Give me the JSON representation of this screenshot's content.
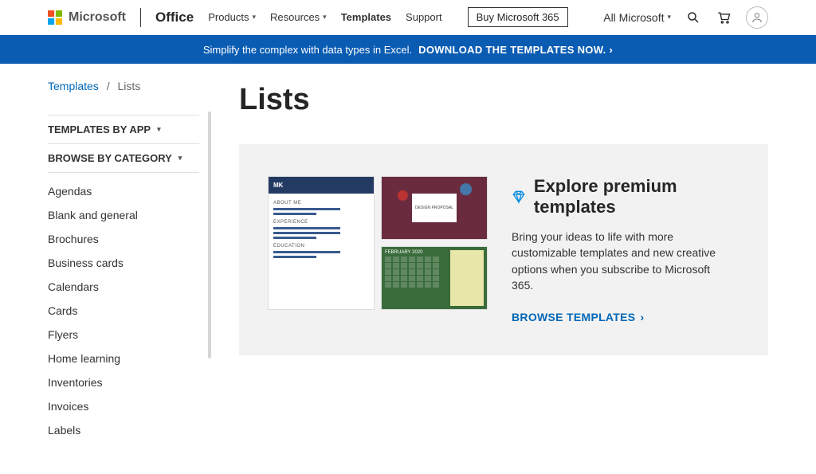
{
  "header": {
    "brand": "Microsoft",
    "product": "Office",
    "nav": {
      "products": "Products",
      "resources": "Resources",
      "templates": "Templates",
      "support": "Support"
    },
    "buy": "Buy Microsoft 365",
    "all_ms": "All Microsoft"
  },
  "promo": {
    "text": "Simplify the complex with data types in Excel.",
    "cta": "DOWNLOAD THE TEMPLATES NOW."
  },
  "breadcrumb": {
    "root": "Templates",
    "current": "Lists"
  },
  "sidebar": {
    "section_app": "TEMPLATES BY APP",
    "section_cat": "BROWSE BY CATEGORY",
    "categories": {
      "0": "Agendas",
      "1": "Blank and general",
      "2": "Brochures",
      "3": "Business cards",
      "4": "Calendars",
      "5": "Cards",
      "6": "Flyers",
      "7": "Home learning",
      "8": "Inventories",
      "9": "Invoices",
      "10": "Labels"
    }
  },
  "page": {
    "title": "Lists"
  },
  "hero": {
    "title": "Explore premium templates",
    "desc": "Bring your ideas to life with more customizable templates and new creative options when you subscribe to Microsoft 365.",
    "cta": "BROWSE TEMPLATES",
    "thumbs": {
      "resume_mk": "MK",
      "resume_about": "ABOUT ME",
      "resume_exp": "EXPERIENCE",
      "resume_edu": "EDUCATION",
      "design_proposal": "DESIGN PROPOSAL",
      "cal_month": "FEBRUARY 2020"
    }
  }
}
